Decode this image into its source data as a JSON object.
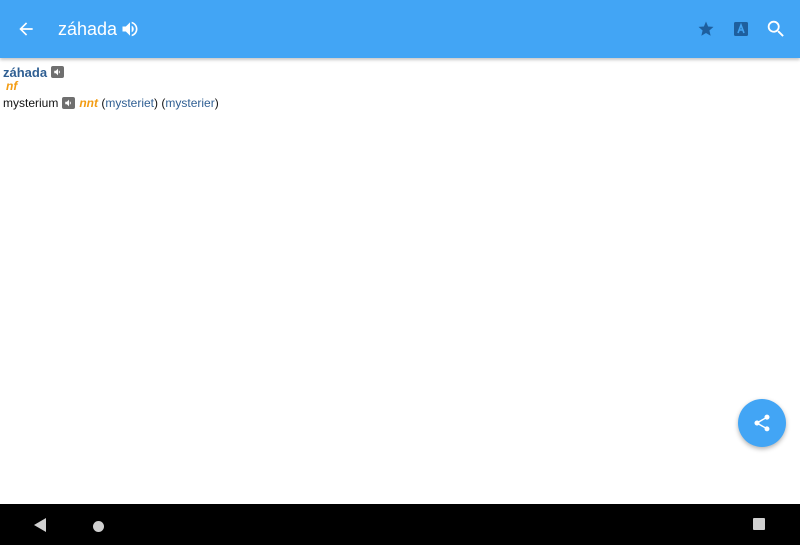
{
  "appbar": {
    "title": "záhada",
    "icons": {
      "back": "arrow-back-icon",
      "speak": "speaker-icon",
      "favorite": "star-icon",
      "transliteration": "letter-a-icon",
      "search": "search-icon"
    },
    "color": "#42a5f5"
  },
  "entry": {
    "headword": "záhada",
    "grammar": "nf",
    "translation": {
      "word": "mysterium",
      "grammar": "nnt",
      "form1": "mysteriet",
      "form2": "mysterier",
      "open_paren": "(",
      "close_paren": ")"
    }
  },
  "fab": {
    "icon": "share-icon"
  },
  "navbar": {
    "icons": [
      "nav-back-icon",
      "nav-home-icon",
      "nav-recents-icon"
    ]
  },
  "colors": {
    "headword": "#2f5f93",
    "grammar": "#f39c12",
    "link": "#2f5f93"
  }
}
